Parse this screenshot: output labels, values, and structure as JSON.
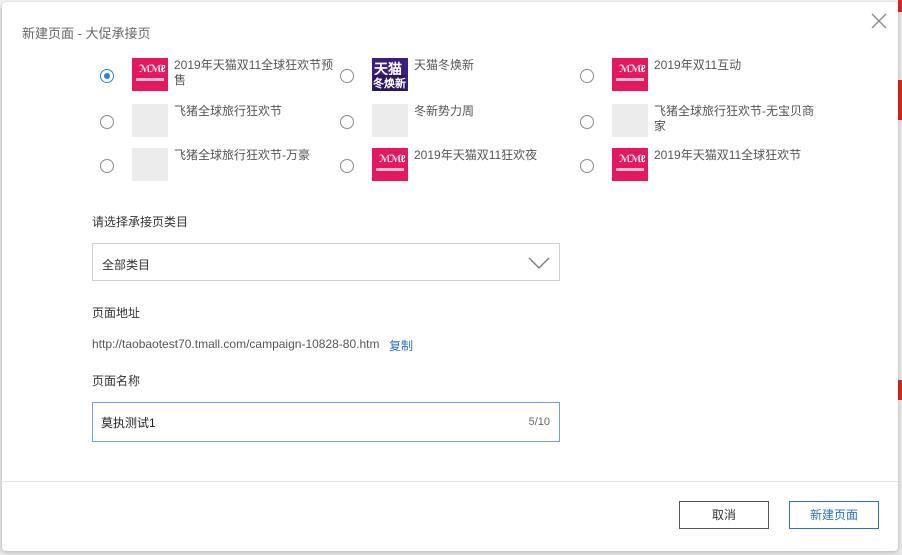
{
  "modal": {
    "title": "新建页面 - 大促承接页"
  },
  "templates": [
    {
      "label": "2019年天猫双11全球狂欢节预售",
      "checked": true,
      "thumb": "pink"
    },
    {
      "label": "天猫冬焕新",
      "checked": false,
      "thumb": "purple",
      "thumb_text_1": "天猫",
      "thumb_text_2": "冬焕新"
    },
    {
      "label": "2019年双11互动",
      "checked": false,
      "thumb": "pink"
    },
    {
      "label": "飞猪全球旅行狂欢节",
      "checked": false,
      "thumb": "blank"
    },
    {
      "label": "冬新势力周",
      "checked": false,
      "thumb": "blank"
    },
    {
      "label": "飞猪全球旅行狂欢节-无宝贝商家",
      "checked": false,
      "thumb": "blank"
    },
    {
      "label": "飞猪全球旅行狂欢节-万豪",
      "checked": false,
      "thumb": "blank"
    },
    {
      "label": "2019年天猫双11狂欢夜",
      "checked": false,
      "thumb": "pink"
    },
    {
      "label": "2019年天猫双11全球狂欢节",
      "checked": false,
      "thumb": "pink"
    }
  ],
  "category": {
    "label": "请选择承接页类目",
    "value": "全部类目"
  },
  "address": {
    "label": "页面地址",
    "url": "http://taobaotest70.tmall.com/campaign-10828-80.htm",
    "copy_label": "复制"
  },
  "page_name": {
    "label": "页面名称",
    "value": "莫执测试1",
    "counter": "5/10"
  },
  "footer": {
    "cancel_label": "取消",
    "create_label": "新建页面"
  },
  "colors": {
    "accent": "#2b82d9",
    "link": "#2b6fc7",
    "thumb_pink": "#e3185f",
    "thumb_purple": "#3b1f7a"
  }
}
